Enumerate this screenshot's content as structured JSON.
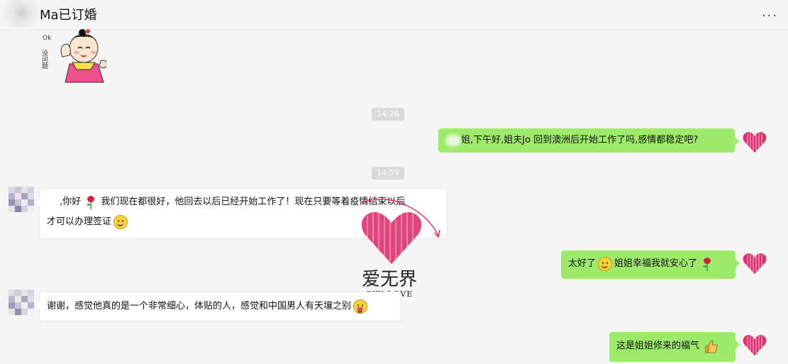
{
  "header": {
    "title": "Ma已订婚",
    "more_label": "···"
  },
  "messages": {
    "time1": "14:26",
    "out1": "姐,下午好,姐夫Jo 回到澳洲后开始工作了吗,感情都稳定吧?",
    "time2": "14:59",
    "in1_a": ",你好",
    "in1_b": "我们现在都很好，他回去以后已经开始工作了！现在只要等着疫情结束以后",
    "in1_c": "才可以办理签证",
    "out2_a": "太好了",
    "out2_b": "姐姐幸福我就安心了",
    "in2": "谢谢，感觉他真的是一个非常细心，体贴的人，感觉和中国男人有天壤之别",
    "out3": "这是姐姐修来的福气"
  },
  "sticker": {
    "text": "ok 没问题"
  },
  "watermark": {
    "name": "爱无界",
    "sub": "SKY LOVE"
  },
  "colors": {
    "out_bubble": "#9eea6a",
    "in_bubble": "#ffffff",
    "heart": "#e0306e",
    "background": "#f5f5f5"
  },
  "icons": [
    "more-icon",
    "rose-icon",
    "smile-icon",
    "wink-icon",
    "thumbs-up-icon",
    "heart-avatar"
  ]
}
